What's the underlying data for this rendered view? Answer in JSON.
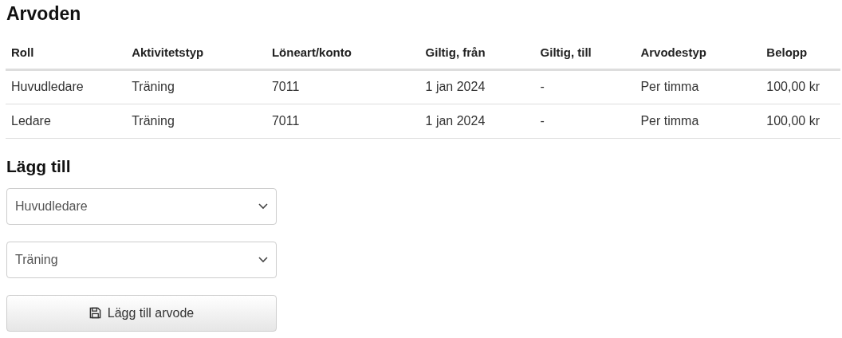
{
  "fees": {
    "title": "Arvoden",
    "columns": [
      "Roll",
      "Aktivitetstyp",
      "Löneart/konto",
      "Giltig, från",
      "Giltig, till",
      "Arvodestyp",
      "Belopp"
    ],
    "rows": [
      [
        "Huvudledare",
        "Träning",
        "7011",
        "1 jan 2024",
        "-",
        "Per timma",
        "100,00 kr"
      ],
      [
        "Ledare",
        "Träning",
        "7011",
        "1 jan 2024",
        "-",
        "Per timma",
        "100,00 kr"
      ]
    ]
  },
  "add": {
    "title": "Lägg till",
    "selects": [
      {
        "value": "Huvudledare"
      },
      {
        "value": "Träning"
      }
    ],
    "button": "Lägg till arvode"
  }
}
